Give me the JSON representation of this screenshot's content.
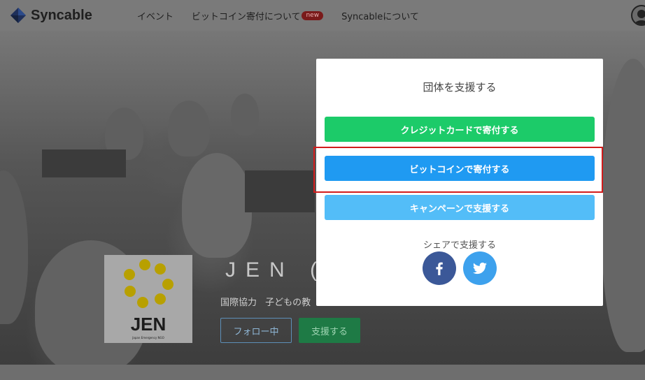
{
  "header": {
    "brand": "Syncable",
    "nav": [
      {
        "label": "イベント"
      },
      {
        "label": "ビットコイン寄付について",
        "badge": "new"
      },
      {
        "label": "Syncableについて"
      }
    ]
  },
  "org": {
    "logo_text": "JEN",
    "logo_subtext": "Japan Emergency NGO",
    "title": "JEN (",
    "tags": [
      "国際協力",
      "子どもの教"
    ],
    "follow_label": "フォロー中",
    "support_label": "支援する"
  },
  "modal": {
    "title": "団体を支援する",
    "card_button": "クレジットカードで寄付する",
    "bitcoin_button": "ビットコインで寄付する",
    "campaign_button": "キャンペーンで支援する",
    "share_label": "シェアで支援する",
    "social": [
      {
        "name": "facebook",
        "icon": "facebook-icon",
        "color": "#3b5898"
      },
      {
        "name": "twitter",
        "icon": "twitter-icon",
        "color": "#3da1ed"
      }
    ]
  },
  "colors": {
    "card_green": "#1ccb69",
    "bitcoin_blue": "#1f9af2",
    "campaign_blue": "#53bdf8",
    "highlight_red": "#d21c1c"
  }
}
